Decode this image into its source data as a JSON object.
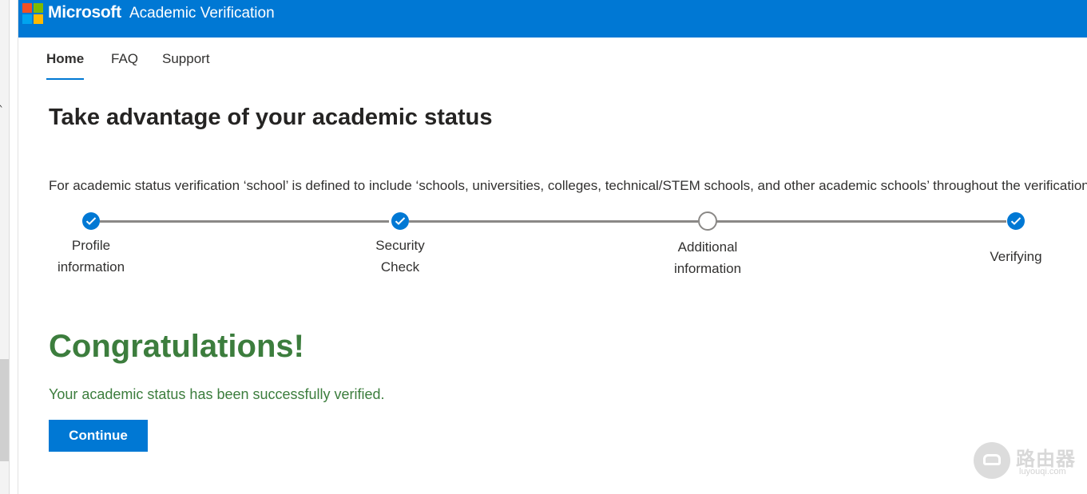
{
  "header": {
    "brand": "Microsoft",
    "app_title": "Academic Verification"
  },
  "nav": {
    "items": [
      {
        "label": "Home",
        "active": true
      },
      {
        "label": "FAQ",
        "active": false
      },
      {
        "label": "Support",
        "active": false
      }
    ]
  },
  "page": {
    "title": "Take advantage of your academic status",
    "definition": "For academic status verification ‘school’ is defined to include ‘schools, universities, colleges, technical/STEM schools, and other academic schools’ throughout the verification"
  },
  "stepper": {
    "steps": [
      {
        "line1": "Profile",
        "line2": "information",
        "status": "completed"
      },
      {
        "line1": "Security",
        "line2": "Check",
        "status": "completed"
      },
      {
        "line1": "Additional",
        "line2": "information",
        "status": "incomplete"
      },
      {
        "line1": "Verifying",
        "line2": "",
        "status": "completed"
      }
    ]
  },
  "result": {
    "heading": "Congratulations!",
    "message": "Your academic status has been successfully verified.",
    "continue_label": "Continue"
  },
  "watermark": {
    "text_cn": "路由器",
    "url": "luyouqi.com"
  },
  "colors": {
    "accent": "#0078d4",
    "success": "#3c7d3d",
    "line": "#8a8886"
  }
}
